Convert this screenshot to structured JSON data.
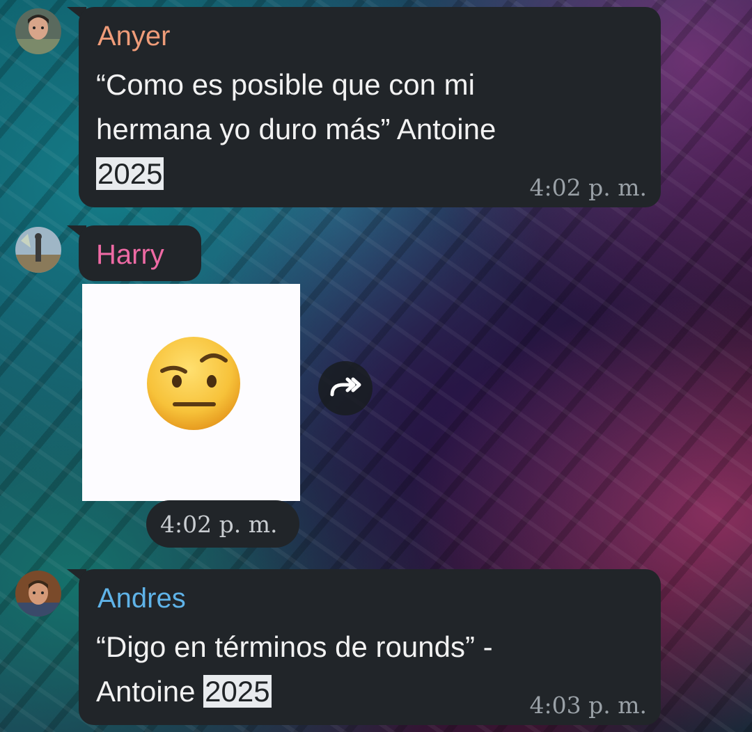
{
  "colors": {
    "bubble": "#212529",
    "name_anyer": "#ef9c79",
    "name_harry": "#ee6aa4",
    "name_andres": "#5fb3e8",
    "timestamp": "#9aa1a7",
    "highlight": "#e8ebee"
  },
  "messages": [
    {
      "sender": "Anyer",
      "text_line1": "“Como es posible que con mi",
      "text_line2": "hermana yo duro más” Antoine",
      "highlight": "2025",
      "time": "4:02 p. m."
    },
    {
      "sender": "Harry",
      "sticker_icon": "raised-eyebrow-emoji-icon",
      "forward_icon": "forward-icon",
      "time": "4:02 p. m."
    },
    {
      "sender": "Andres",
      "text_line1": "“Digo en términos de rounds” -",
      "text_line2_prefix": "Antoine ",
      "highlight": "2025",
      "time": "4:03 p. m."
    }
  ]
}
